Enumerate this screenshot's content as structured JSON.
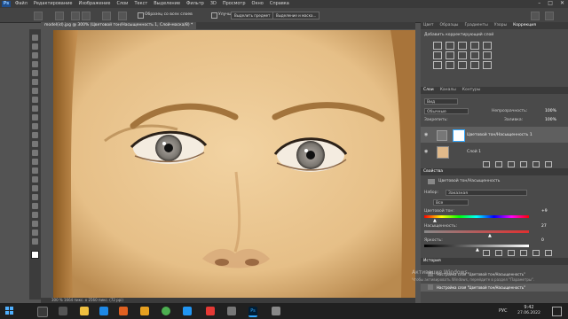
{
  "menu": [
    "Файл",
    "Редактирование",
    "Изображение",
    "Слои",
    "Текст",
    "Выделение",
    "Фильтр",
    "3D",
    "Просмотр",
    "Окно",
    "Справка"
  ],
  "app_icon": "Ps",
  "options_bar": {
    "sample_all_layers": "Образец со всех слоев",
    "enhance_edge": "Улучшить край",
    "select_subject": "Выделить предмет",
    "select_and_mask": "Выделение и маска..."
  },
  "document": {
    "tab_title": "model(id).jpg @ 300% (Цветовой тон/Насыщенность 1, Слой-маска/8) *",
    "status": "300 %    1664 пикс. x 2560 пикс. (72 ppi)"
  },
  "right_panel": {
    "top_tabs": [
      "Цвет",
      "Образцы",
      "Градиенты",
      "Узоры",
      "Коррекция"
    ],
    "adjustments_title": "Добавить корректирующий слой",
    "layers_tabs": [
      "Слои",
      "Каналы",
      "Контуры"
    ],
    "layers_kind": "Вид",
    "blend_mode": "Обычные",
    "opacity_label": "Непрозрачность:",
    "opacity_value": "100%",
    "lock_label": "Закрепить:",
    "fill_label": "Заливка:",
    "fill_value": "100%",
    "layers": [
      {
        "name": "Цветовой тон/Насыщенность 1"
      },
      {
        "name": "Слой 1"
      }
    ],
    "properties_tab": "Свойства",
    "properties_title": "Цветовой тон/Насыщенность",
    "preset_label": "Набор:",
    "preset_value": "Заказная",
    "channel_value": "Все",
    "hue_label": "Цветовой тон:",
    "hue_value": "+9",
    "saturation_label": "Насыщенность:",
    "saturation_value": "27",
    "lightness_label": "Яркость:",
    "lightness_value": "0",
    "history_tab": "История",
    "history_items": [
      "Настройка слоя \"Цветовой тон/Насыщенность\"",
      "Настройка слоя \"Цветовой тон/Насыщенность\""
    ],
    "watermark_1": "Активация Windows",
    "watermark_2": "Чтобы активировать Windows, перейдите в раздел \"Параметры\"."
  },
  "taskbar": {
    "lang": "РУС",
    "time": "9:42",
    "date": "27.06.2022"
  },
  "colors": {
    "accent": "#31a8ff",
    "panel": "#4a4a4a",
    "skin": "#e9c48f"
  }
}
